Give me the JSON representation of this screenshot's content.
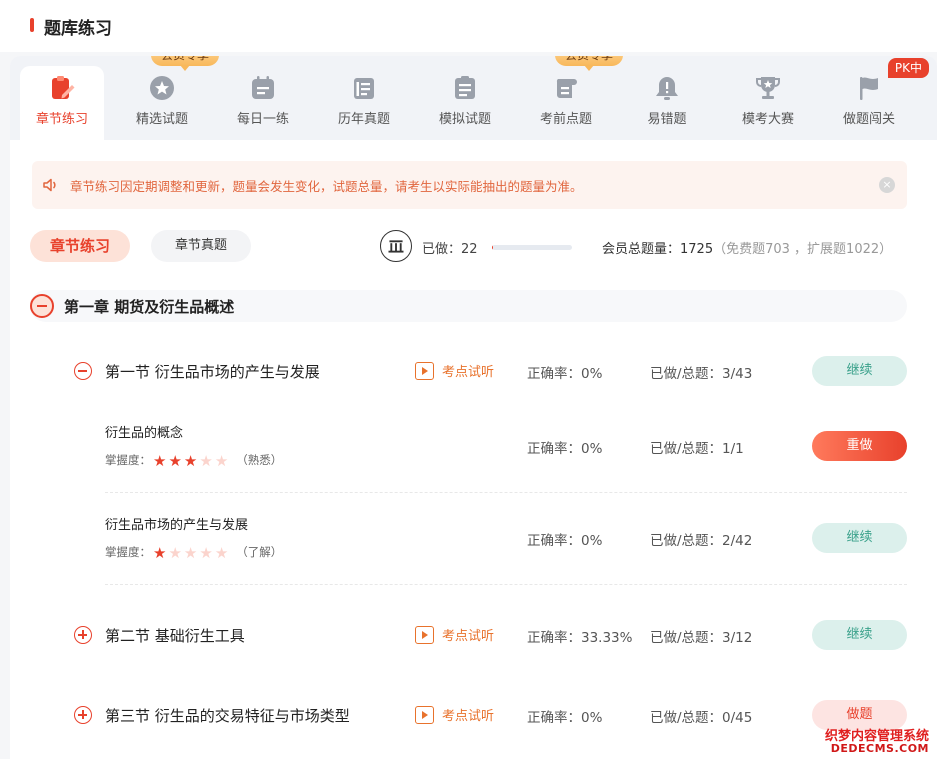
{
  "page": {
    "title": "题库练习"
  },
  "tabs": [
    {
      "label": "章节练习",
      "icon": "clipboard-pen-icon",
      "active": true
    },
    {
      "label": "精选试题",
      "icon": "star-badge-icon",
      "badge": "会员专享"
    },
    {
      "label": "每日一练",
      "icon": "calendar-icon"
    },
    {
      "label": "历年真题",
      "icon": "book-icon"
    },
    {
      "label": "模拟试题",
      "icon": "clipboard-list-icon"
    },
    {
      "label": "考前点题",
      "icon": "scroll-icon",
      "badge": "会员专享"
    },
    {
      "label": "易错题",
      "icon": "alert-bell-icon"
    },
    {
      "label": "模考大赛",
      "icon": "trophy-icon"
    },
    {
      "label": "做题闯关",
      "icon": "flag-icon",
      "badge": "PK中"
    }
  ],
  "notice": {
    "text": "章节练习因定期调整和更新，题量会发生变化，试题总量，请考生以实际能抽出的题量为准。",
    "close_label": "×"
  },
  "filters": {
    "active": "章节练习",
    "inactive": "章节真题"
  },
  "stats": {
    "done_label": "已做：",
    "done_value": "22",
    "progress_fraction": 0.0128,
    "total_label": "会员总题量：",
    "total_value": "1725",
    "total_detail": "（免费题703 ，扩展题1022）"
  },
  "chapter": {
    "title": "第一章 期货及衍生品概述"
  },
  "sections": [
    {
      "title": "第一节 衍生品市场的产生与发展",
      "expanded": true,
      "audio": "考点试听",
      "accuracy": "正确率：0%",
      "count": "已做/总题：3/43",
      "button": "继续",
      "button_type": "cont"
    },
    {
      "title": "第二节 基础衍生工具",
      "expanded": false,
      "audio": "考点试听",
      "accuracy": "正确率：33.33%",
      "count": "已做/总题：3/12",
      "button": "继续",
      "button_type": "cont"
    },
    {
      "title": "第三节 衍生品的交易特征与市场类型",
      "expanded": false,
      "audio": "考点试听",
      "accuracy": "正确率：0%",
      "count": "已做/总题：0/45",
      "button": "做题",
      "button_type": "do"
    }
  ],
  "knowledge_points": [
    {
      "title": "衍生品的概念",
      "mastery_label": "掌握度：",
      "stars": 3,
      "level": "（熟悉）",
      "accuracy": "正确率：0%",
      "count": "已做/总题：1/1",
      "button": "重做"
    },
    {
      "title": "衍生品市场的产生与发展",
      "mastery_label": "掌握度：",
      "stars": 1,
      "level": "（了解）",
      "accuracy": "正确率：0%",
      "count": "已做/总题：2/42",
      "button": "继续"
    }
  ],
  "watermark": {
    "line1": "织梦内容管理系统",
    "line2": "DEDECMS.COM"
  },
  "colors": {
    "accent": "#e8412c",
    "continue_bg": "#dcf0ec",
    "continue_text": "#3aa18b",
    "vip_gold": "#f8b85b"
  }
}
